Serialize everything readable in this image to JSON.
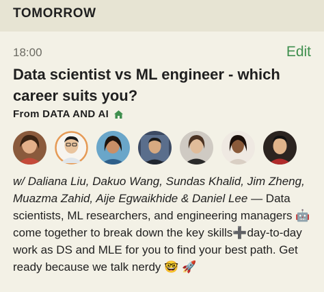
{
  "section": {
    "label": "TOMORROW"
  },
  "event": {
    "time": "18:00",
    "edit_label": "Edit",
    "title": "Data scientist vs ML engineer - which career suits you?",
    "club_prefix": "From",
    "club_name": "DATA AND AI",
    "hosts_line": "w/ Daliana Liu, Dakuo Wang, Sundas Khalid, Jim Zheng, Muazma Zahid, Aije Egwaikhide & Daniel Lee",
    "description": "— Data scientists, ML researchers, and engineering managers 🤖 come together to break down the key skills➕day-to-day work as DS and MLE for you to find your best path. Get ready because we talk nerdy 🤓 🚀"
  },
  "colors": {
    "background": "#f3f1e6",
    "header_bg": "#e7e4d3",
    "accent_green": "#3f8f4e",
    "text": "#1f1f1f",
    "muted": "#6b6a62"
  },
  "icons": {
    "club": "house-icon"
  }
}
